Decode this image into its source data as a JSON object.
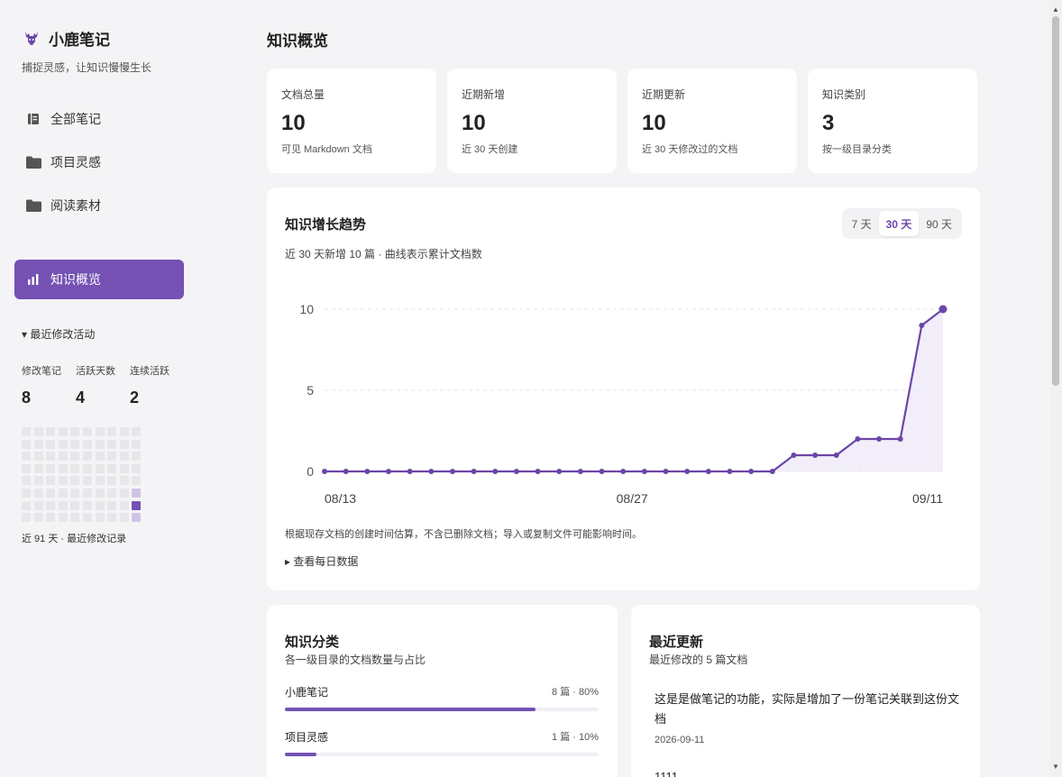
{
  "brand": {
    "name": "小鹿笔记",
    "tagline": "捕捉灵感，让知识慢慢生长",
    "accent": "#7451b3"
  },
  "nav": [
    {
      "label": "全部笔记",
      "icon": "notes-icon"
    },
    {
      "label": "项目灵感",
      "icon": "folder-icon"
    },
    {
      "label": "阅读素材",
      "icon": "folder-icon"
    },
    {
      "label": "知识概览",
      "icon": "bar-chart-icon",
      "active": true
    }
  ],
  "activity": {
    "toggle": "▾ 最近修改活动",
    "stats": [
      {
        "label": "修改笔记",
        "value": "8"
      },
      {
        "label": "活跃天数",
        "value": "4"
      },
      {
        "label": "连续活跃",
        "value": "2"
      }
    ],
    "footer": "近 91 天 · 最近修改记录"
  },
  "page": {
    "title": "知识概览"
  },
  "cards": [
    {
      "label": "文档总量",
      "value": "10",
      "note": "可见 Markdown 文档"
    },
    {
      "label": "近期新增",
      "value": "10",
      "note": "近 30 天创建"
    },
    {
      "label": "近期更新",
      "value": "10",
      "note": "近 30 天修改过的文档"
    },
    {
      "label": "知识类别",
      "value": "3",
      "note": "按一级目录分类"
    }
  ],
  "trend": {
    "title": "知识增长趋势",
    "subtitle": "近 30 天新增 10 篇 · 曲线表示累计文档数",
    "ranges": [
      "7 天",
      "30 天",
      "90 天"
    ],
    "selected_range": "30 天",
    "note": "根据现存文档的创建时间估算，不含已删除文档；导入或复制文件可能影响时间。",
    "toggle": "▸ 查看每日数据"
  },
  "chart_data": {
    "type": "area",
    "x_ticks": [
      "08/13",
      "08/27",
      "09/11"
    ],
    "y_ticks": [
      "0",
      "5",
      "10"
    ],
    "ylim": [
      0,
      10
    ],
    "grid": true,
    "values": [
      0,
      0,
      0,
      0,
      0,
      0,
      0,
      0,
      0,
      0,
      0,
      0,
      0,
      0,
      0,
      0,
      0,
      0,
      0,
      0,
      0,
      0,
      1,
      1,
      1,
      2,
      2,
      2,
      9,
      10
    ],
    "color": "#6b46a8"
  },
  "categories": {
    "title": "知识分类",
    "subtitle": "各一级目录的文档数量与占比",
    "items": [
      {
        "name": "小鹿笔记",
        "count": "8 篇 · 80%",
        "pct": 0.8
      },
      {
        "name": "项目灵感",
        "count": "1 篇 · 10%",
        "pct": 0.1
      }
    ]
  },
  "recent": {
    "title": "最近更新",
    "subtitle": "最近修改的 5 篇文档",
    "items": [
      {
        "title": "这是是做笔记的功能，实际是增加了一份笔记关联到这份文档",
        "date": "2026-09-11"
      },
      {
        "title": "1111",
        "date": ""
      }
    ]
  }
}
